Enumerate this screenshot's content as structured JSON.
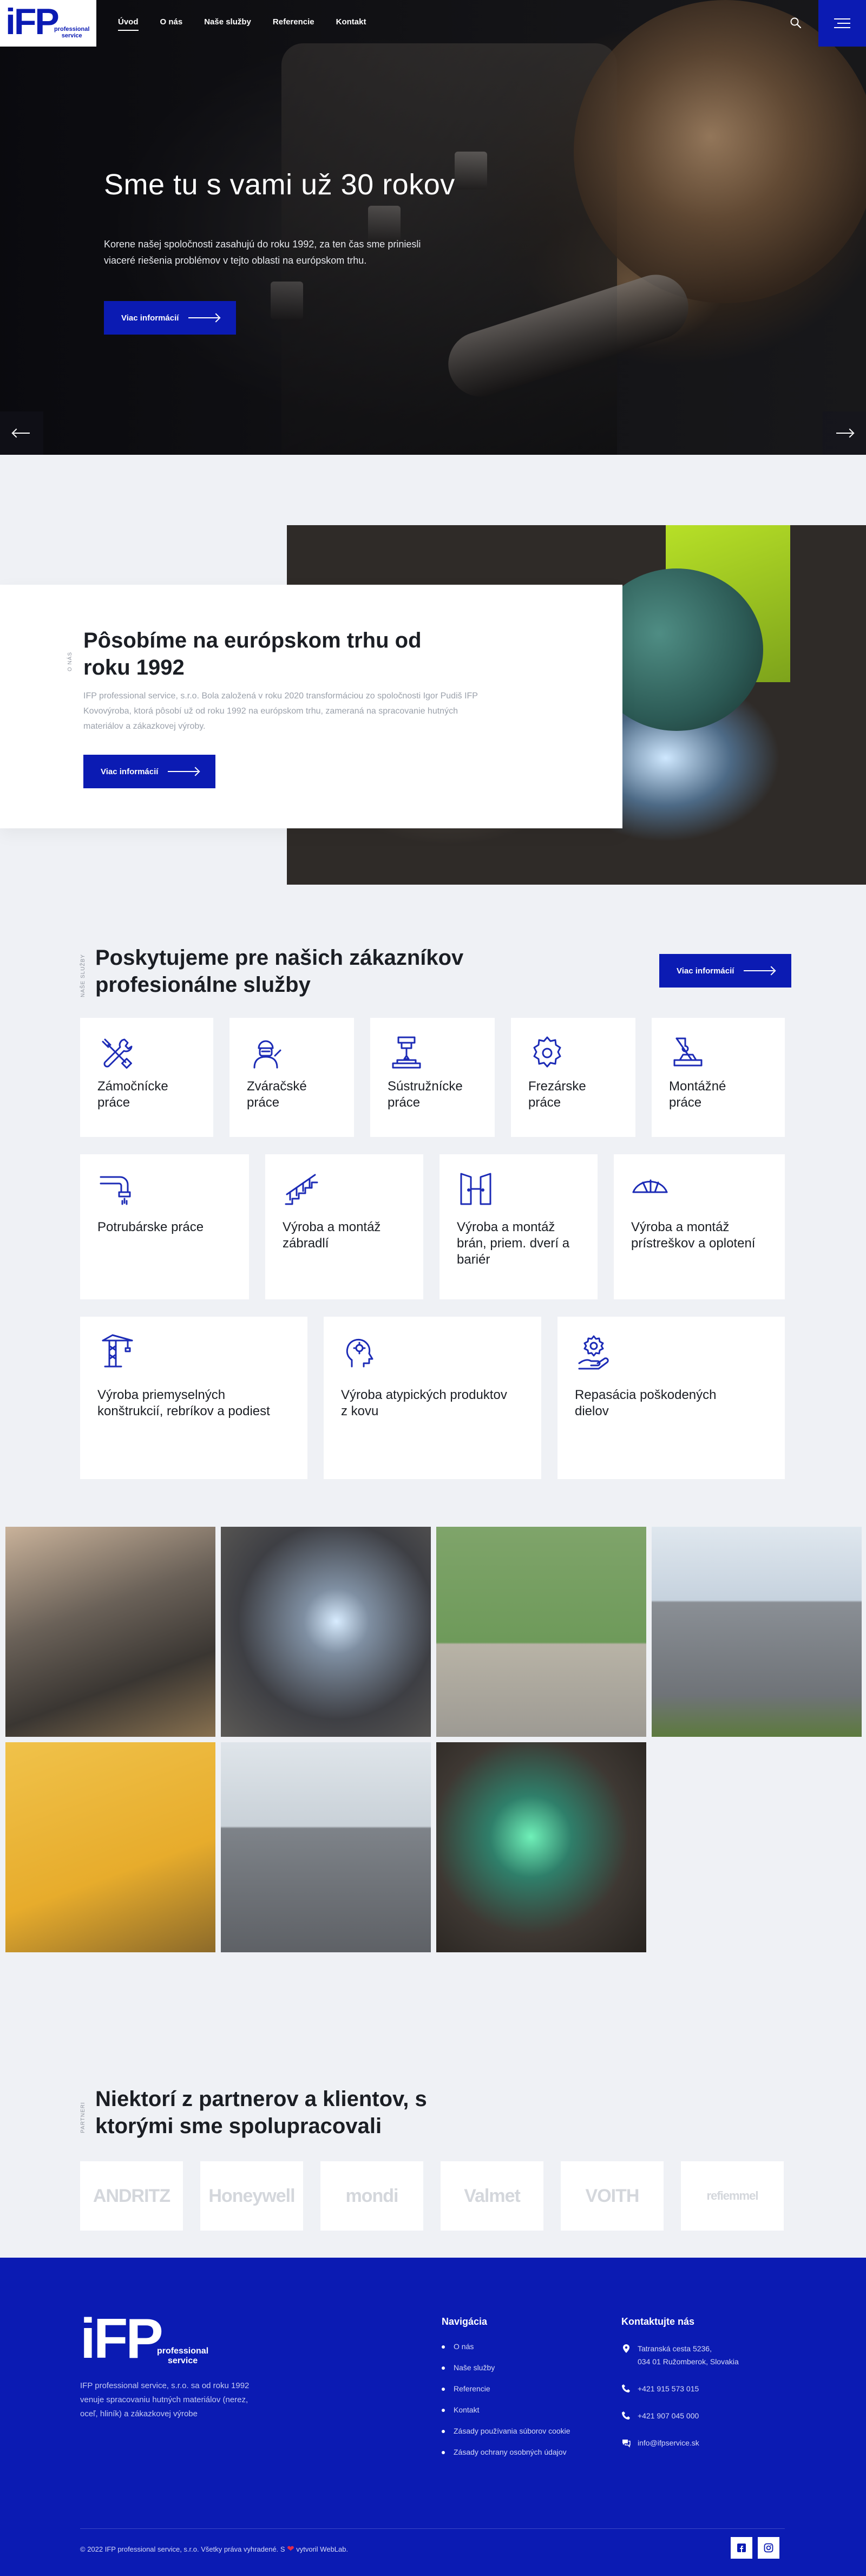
{
  "header": {
    "logo_text": "iFP",
    "logo_sub_1": "professional",
    "logo_sub_2": "service",
    "nav": [
      {
        "label": "Úvod"
      },
      {
        "label": "O nás"
      },
      {
        "label": "Naše služby"
      },
      {
        "label": "Referencie"
      },
      {
        "label": "Kontakt"
      }
    ]
  },
  "hero": {
    "title": "Sme tu s vami už 30 rokov",
    "text": "Korene našej spoločnosti zasahujú do roku 1992, za ten čas sme priniesli viaceré riešenia problémov v tejto oblasti na európskom trhu.",
    "button": "Viac informácií"
  },
  "about": {
    "label": "O nás",
    "title": "Pôsobíme na európskom trhu od roku 1992",
    "text": "IFP professional service, s.r.o. Bola založená v roku 2020 transformáciou zo spoločnosti Igor Pudiš IFP Kovovýroba, ktorá pôsobí už od roku 1992 na európskom trhu, zameraná na spracovanie hutných materiálov a zákazkovej výroby.",
    "button": "Viac informácií"
  },
  "services": {
    "label": "Naše služby",
    "title": "Poskytujeme pre našich zákazníkov profesionálne služby",
    "button": "Viac informácií",
    "row1": [
      "Zámočnícke práce",
      "Zváračské práce",
      "Sústružnícke práce",
      "Frezárske práce",
      "Montážné práce"
    ],
    "row2": [
      "Potrubárske práce",
      "Výroba a montáž zábradlí",
      "Výroba a montáž brán, priem. dverí a bariér",
      "Výroba a montáž prístreškov a oplotení"
    ],
    "row3": [
      "Výroba priemyselných konštrukcií, rebríkov a podiest",
      "Výroba atypických produktov z kovu",
      "Repasácia poškodených dielov"
    ]
  },
  "partners": {
    "label": "Partneri",
    "title": "Niektorí z partnerov a klientov, s ktorými sme spolupracovali",
    "logos": [
      "ANDRITZ",
      "Honeywell",
      "mondi",
      "Valmet",
      "VOITH",
      "refiemmel"
    ]
  },
  "footer": {
    "logo_text": "iFP",
    "logo_sub_1": "professional",
    "logo_sub_2": "service",
    "description": "IFP professional service, s.r.o. sa od roku 1992 venuje spracovaniu hutných materiálov (nerez, oceľ, hliník) a zákazkovej výrobe",
    "nav_title": "Navigácia",
    "nav": [
      "O nás",
      "Naše služby",
      "Referencie",
      "Kontakt",
      "Zásady používania súborov cookie",
      "Zásady ochrany osobných údajov"
    ],
    "contact_title": "Kontaktujte nás",
    "address_1": "Tatranská cesta 5236,",
    "address_2": "034 01 Ružomberok, Slovakia",
    "phone_1": "+421 915 573 015",
    "phone_2": "+421 907 045 000",
    "email": "info@ifpservice.sk",
    "copyright": "© 2022 IFP professional service, s.r.o. Všetky práva vyhradené. S",
    "copyright_end": "vytvoril WebLab.",
    "colors": {
      "brand": "#0b1bb3",
      "heart": "#e22b4b"
    }
  }
}
